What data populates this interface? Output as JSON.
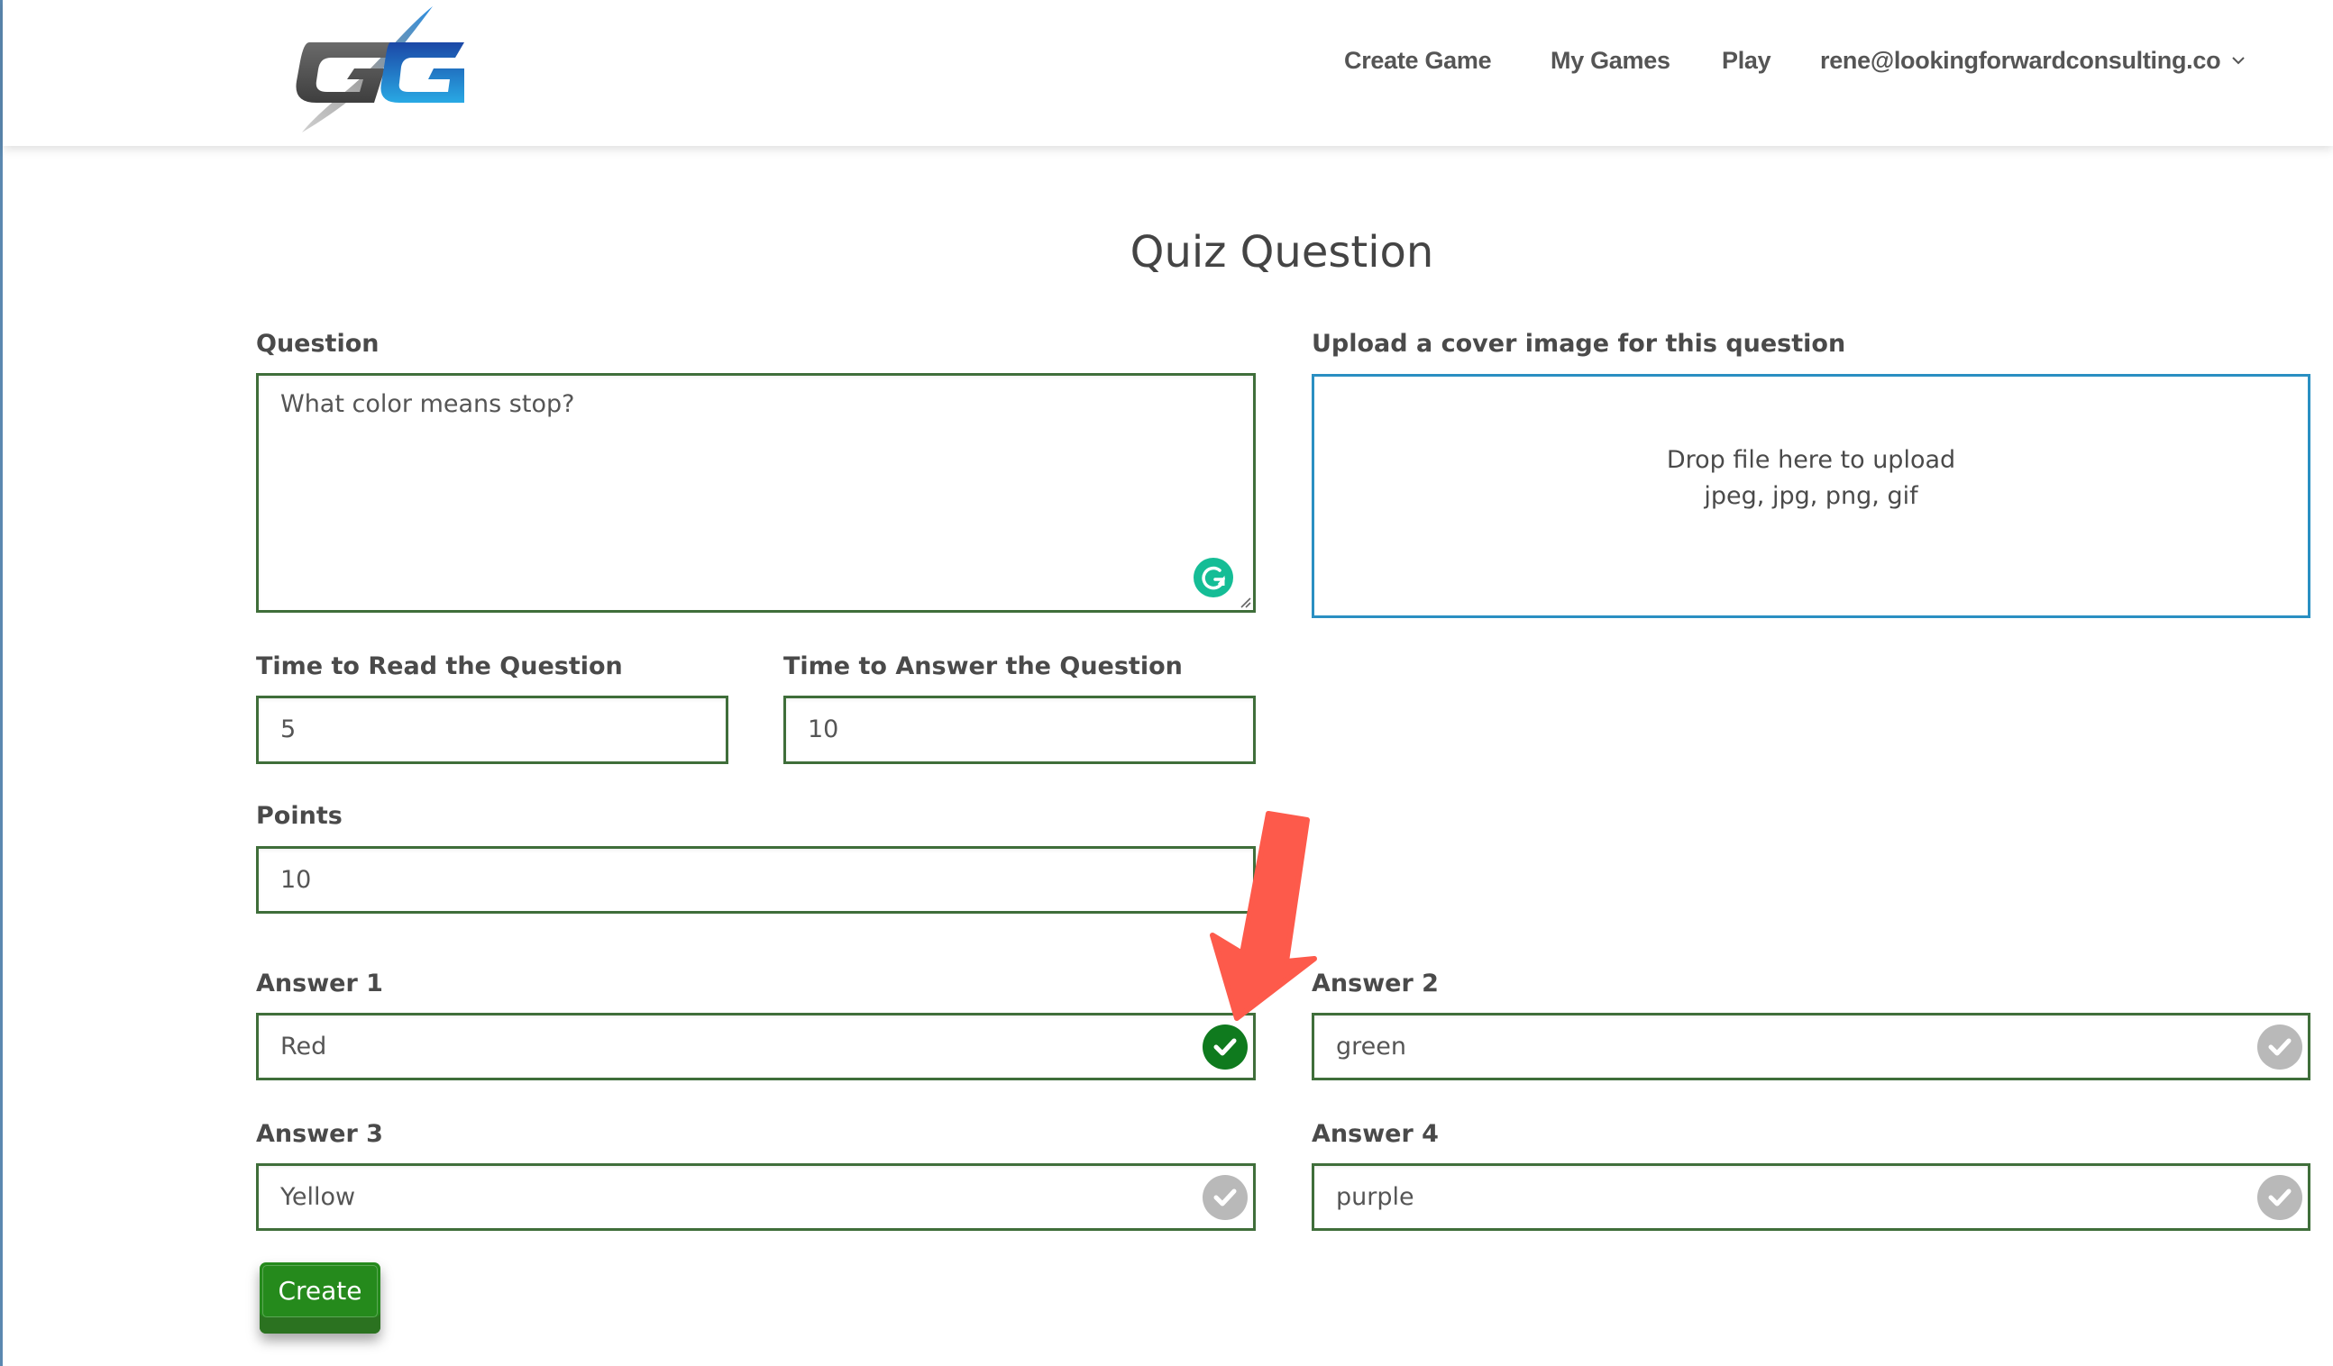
{
  "header": {
    "logo": {
      "name": "GG logo",
      "colors": {
        "grey": "#555555",
        "blue": "#1f6fc7"
      }
    },
    "nav": {
      "items": [
        {
          "label": "Create Game"
        },
        {
          "label": "My Games"
        },
        {
          "label": "Play"
        }
      ],
      "account": {
        "label": "rene@lookingforwardconsulting.co",
        "icon": "chevron-down-icon"
      }
    }
  },
  "page": {
    "title": "Quiz Question"
  },
  "form": {
    "question": {
      "label": "Question",
      "value": "What color means stop?",
      "extension_icon": "grammarly-icon"
    },
    "upload": {
      "label": "Upload a cover image for this question",
      "drop_text": "Drop file here to upload",
      "formats": "jpeg, jpg, png, gif"
    },
    "time_to_read": {
      "label": "Time to Read the Question",
      "value": "5"
    },
    "time_to_answer": {
      "label": "Time to Answer the Question",
      "value": "10"
    },
    "points": {
      "label": "Points",
      "value": "10"
    },
    "answers": [
      {
        "label": "Answer 1",
        "value": "Red",
        "correct": true
      },
      {
        "label": "Answer 2",
        "value": "green",
        "correct": false
      },
      {
        "label": "Answer 3",
        "value": "Yellow",
        "correct": false
      },
      {
        "label": "Answer 4",
        "value": "purple",
        "correct": false
      }
    ],
    "submit_label": "Create"
  },
  "annotation": {
    "type": "arrow",
    "color": "#fd5a4b",
    "points_to": "answer-1-correct-toggle"
  },
  "colors": {
    "field_border": "#3f6e3a",
    "upload_border": "#2a8fc2",
    "correct": "#0f7a1e",
    "incorrect": "#b9b9b9",
    "button": "#258a1c"
  }
}
